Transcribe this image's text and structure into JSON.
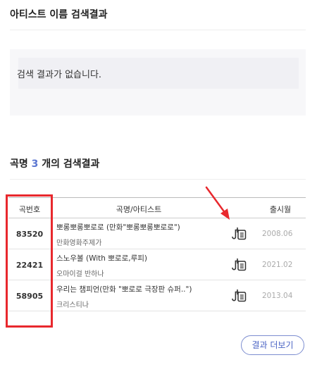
{
  "artist_section": {
    "title": "아티스트 이름 검색결과",
    "empty_message": "검색 결과가 없습니다."
  },
  "song_section": {
    "title_prefix": "곡명 ",
    "count": "3",
    "title_suffix": " 개의 검색결과"
  },
  "table": {
    "headers": {
      "number": "곡번호",
      "title": "곡명/아티스트",
      "date": "출시월"
    },
    "rows": [
      {
        "number": "83520",
        "title": "뽀롱뽀롱뽀로로 (만화\"뽀롱뽀롱뽀로로\")",
        "artist": "만화영화주제가",
        "date": "2008.06",
        "icon": "lyrics-icon"
      },
      {
        "number": "22421",
        "title": "스노우볼 (With 뽀로로,루피)",
        "artist": "오마이걸 반하나",
        "date": "2021.02",
        "icon": "lyrics-icon"
      },
      {
        "number": "58905",
        "title": "우리는 챔피언(만화 \"뽀로로 극장판 슈퍼..\")",
        "artist": "크리스티나",
        "date": "2013.04",
        "icon": "lyrics-icon"
      }
    ]
  },
  "more_button": "결과 더보기",
  "colors": {
    "accent": "#5b76d1",
    "annotation": "#e8282d"
  }
}
